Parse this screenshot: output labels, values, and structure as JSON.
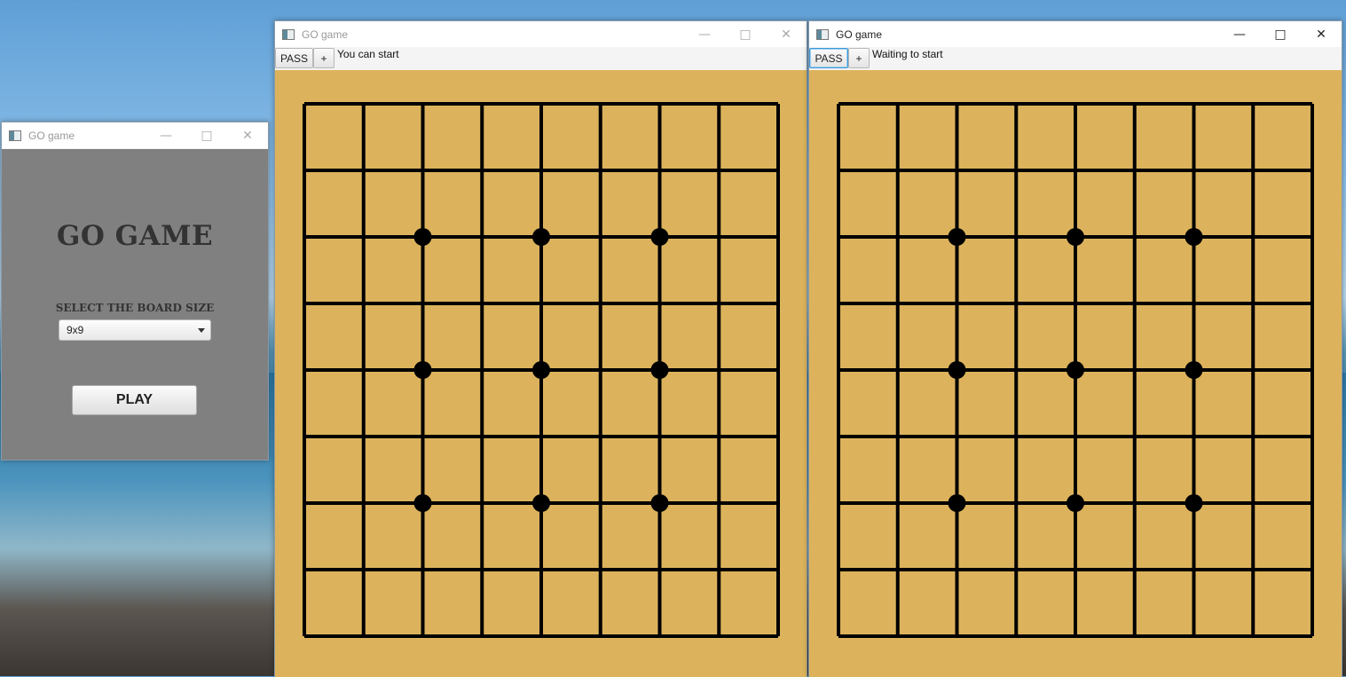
{
  "menu_window": {
    "title": "GO game",
    "heading": "GO GAME",
    "board_size_label": "SELECT THE BOARD SIZE",
    "board_size_value": "9x9",
    "play_label": "PLAY",
    "controls": {
      "minimize": "—",
      "maximize": "□",
      "close": "✕"
    }
  },
  "game_windows": [
    {
      "title": "GO game",
      "pass_label": "PASS",
      "plus_label": "+",
      "status": "You can start",
      "active": false
    },
    {
      "title": "GO game",
      "pass_label": "PASS",
      "plus_label": "+",
      "status": "Waiting to start",
      "active": true
    }
  ],
  "board": {
    "size": 9,
    "star_points": [
      [
        2,
        2
      ],
      [
        4,
        2
      ],
      [
        6,
        2
      ],
      [
        2,
        4
      ],
      [
        4,
        4
      ],
      [
        6,
        4
      ],
      [
        2,
        6
      ],
      [
        4,
        6
      ],
      [
        6,
        6
      ]
    ],
    "board_color": "#dcb35c",
    "line_color": "#000000"
  },
  "icons": [
    "app-icon",
    "minimize-icon",
    "maximize-icon",
    "close-icon",
    "dropdown-arrow-icon"
  ]
}
